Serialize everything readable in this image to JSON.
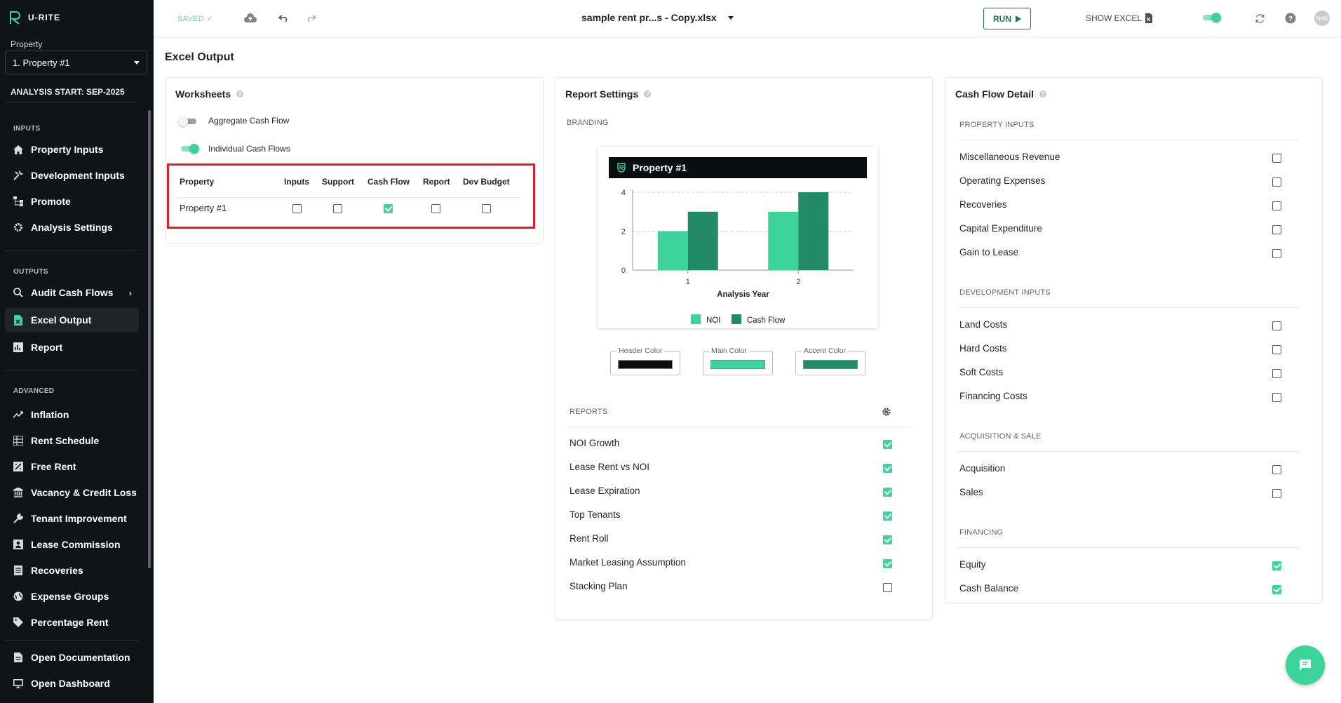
{
  "sidebar": {
    "brand": "U-RITE",
    "property_label": "Property",
    "property_selected": "1. Property #1",
    "analysis_start": "ANALYSIS START: SEP-2025",
    "sections": {
      "inputs": "INPUTS",
      "outputs": "OUTPUTS",
      "advanced": "ADVANCED"
    },
    "inputs_items": [
      {
        "label": "Property Inputs",
        "icon": "home-icon"
      },
      {
        "label": "Development Inputs",
        "icon": "tools-icon"
      },
      {
        "label": "Promote",
        "icon": "hierarchy-icon"
      },
      {
        "label": "Analysis Settings",
        "icon": "gear-icon"
      }
    ],
    "outputs_items": [
      {
        "label": "Audit Cash Flows",
        "icon": "search-icon"
      },
      {
        "label": "Excel Output",
        "icon": "excel-icon"
      },
      {
        "label": "Report",
        "icon": "report-icon"
      }
    ],
    "advanced_items": [
      {
        "label": "Inflation",
        "icon": "trend-icon"
      },
      {
        "label": "Rent Schedule",
        "icon": "table-icon"
      },
      {
        "label": "Free Rent",
        "icon": "free-rent-icon"
      },
      {
        "label": "Vacancy & Credit Loss",
        "icon": "bank-icon"
      },
      {
        "label": "Tenant Improvement",
        "icon": "wrench-icon"
      },
      {
        "label": "Lease Commission",
        "icon": "badge-icon"
      },
      {
        "label": "Recoveries",
        "icon": "list-icon"
      },
      {
        "label": "Expense Groups",
        "icon": "globe-icon"
      },
      {
        "label": "Percentage Rent",
        "icon": "tag-icon"
      }
    ],
    "footer_items": [
      {
        "label": "Open Documentation",
        "icon": "document-icon"
      },
      {
        "label": "Open Dashboard",
        "icon": "monitor-icon"
      }
    ]
  },
  "topbar": {
    "saved": "SAVED",
    "filename": "sample rent pr...s - Copy.xlsx",
    "run": "RUN",
    "show_excel": "SHOW EXCEL",
    "avatar": "NaN"
  },
  "page_title": "Excel Output",
  "worksheets": {
    "title": "Worksheets",
    "aggregate_label": "Aggregate Cash Flow",
    "aggregate_on": false,
    "individual_label": "Individual Cash Flows",
    "individual_on": true,
    "columns": [
      "Property",
      "Inputs",
      "Support",
      "Cash Flow",
      "Report",
      "Dev Budget"
    ],
    "rows": [
      {
        "property": "Property #1",
        "inputs": false,
        "support": false,
        "cash_flow": true,
        "report": false,
        "dev_budget": false
      }
    ]
  },
  "report_settings": {
    "title": "Report Settings",
    "branding": "BRANDING",
    "preview_title": "Property #1",
    "header_color_label": "Header Color",
    "main_color_label": "Main Color",
    "accent_color_label": "Accent Color",
    "colors": {
      "header": "#0b0d0e",
      "main": "#3dd49b",
      "accent": "#228a66"
    },
    "reports_label": "REPORTS",
    "reports": [
      {
        "label": "NOI Growth",
        "checked": true
      },
      {
        "label": "Lease Rent vs NOI",
        "checked": true
      },
      {
        "label": "Lease Expiration",
        "checked": true
      },
      {
        "label": "Top Tenants",
        "checked": true
      },
      {
        "label": "Rent Roll",
        "checked": true
      },
      {
        "label": "Market Leasing Assumption",
        "checked": true
      },
      {
        "label": "Stacking Plan",
        "checked": false
      }
    ]
  },
  "chart_data": {
    "type": "bar",
    "categories": [
      "1",
      "2"
    ],
    "series": [
      {
        "name": "NOI",
        "values": [
          2,
          3
        ],
        "color": "#3dd49b"
      },
      {
        "name": "Cash Flow",
        "values": [
          3,
          4
        ],
        "color": "#228a66"
      }
    ],
    "xlabel": "Analysis Year",
    "ylabel": "",
    "ylim": [
      0,
      4
    ],
    "yticks": [
      "0",
      "2",
      "4"
    ],
    "grid": true,
    "legend": "bottom"
  },
  "cash_flow_detail": {
    "title": "Cash Flow Detail",
    "groups": [
      {
        "heading": "PROPERTY INPUTS",
        "items": [
          {
            "label": "Miscellaneous Revenue",
            "checked": false
          },
          {
            "label": "Operating Expenses",
            "checked": false
          },
          {
            "label": "Recoveries",
            "checked": false
          },
          {
            "label": "Capital Expenditure",
            "checked": false
          },
          {
            "label": "Gain to Lease",
            "checked": false
          }
        ]
      },
      {
        "heading": "DEVELOPMENT INPUTS",
        "items": [
          {
            "label": "Land Costs",
            "checked": false
          },
          {
            "label": "Hard Costs",
            "checked": false
          },
          {
            "label": "Soft Costs",
            "checked": false
          },
          {
            "label": "Financing Costs",
            "checked": false
          }
        ]
      },
      {
        "heading": "ACQUISITION & SALE",
        "items": [
          {
            "label": "Acquisition",
            "checked": false
          },
          {
            "label": "Sales",
            "checked": false
          }
        ]
      },
      {
        "heading": "FINANCING",
        "items": [
          {
            "label": "Equity",
            "checked": true
          },
          {
            "label": "Cash Balance",
            "checked": true
          }
        ]
      }
    ]
  }
}
